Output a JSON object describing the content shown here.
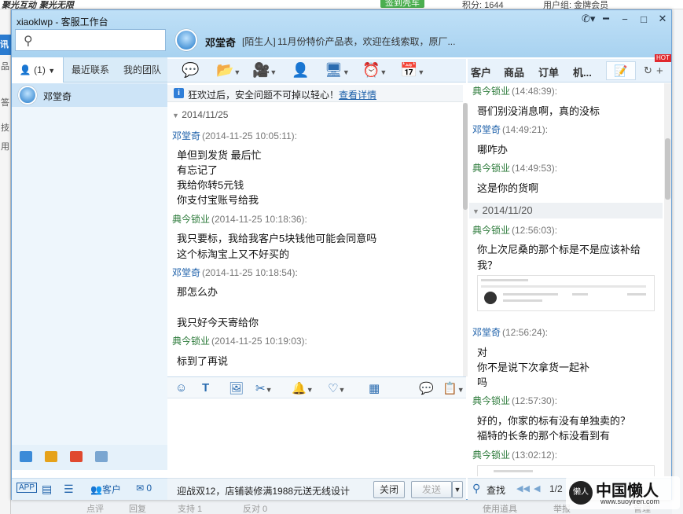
{
  "background": {
    "brand": "聚光互动 聚光无限",
    "signin_button": "签到壳车",
    "points": "积分: 1644",
    "group": "用户组: 金牌会员",
    "left_tab": "讯",
    "left_texts": [
      "品",
      "答",
      "技",
      "用"
    ],
    "bottom_items": [
      "点评",
      "回复",
      "支持 1",
      "反对 0",
      "使用道具",
      "举报",
      "管理"
    ]
  },
  "watermark": {
    "title": "中国懒人",
    "url": "www.suoyiren.com"
  },
  "window": {
    "title": "xiaoklwp - 客服工作台"
  },
  "search": {
    "placeholder": ""
  },
  "left_tabs": [
    {
      "label": "(1)"
    },
    {
      "label": "最近联系"
    },
    {
      "label": "我的团队"
    }
  ],
  "contacts": [
    {
      "name": "邓堂奇"
    }
  ],
  "left_bottom": {
    "app": "APP",
    "customers": "客户",
    "mail_count": "0"
  },
  "chat": {
    "name": "邓堂奇",
    "tag": "[陌生人]",
    "signature": "11月份特价产品表，欢迎在线索取，原厂..."
  },
  "notice": {
    "text": "狂欢过后，安全问题不可掉以轻心！",
    "link": "查看详情"
  },
  "messages": {
    "date": "2014/11/25",
    "m1": {
      "sender": "邓堂奇",
      "time": "(2014-11-25 10:05:11):",
      "lines": [
        "单但到发货 最后忙",
        "有忘记了",
        "我给你转5元钱",
        "你支付宝账号给我"
      ]
    },
    "m2": {
      "sender": "典今锁业",
      "time": "(2014-11-25 10:18:36):",
      "lines": [
        "我只要标，我给我客户5块钱他可能会同意吗",
        "这个标淘宝上又不好买的"
      ]
    },
    "m3": {
      "sender": "邓堂奇",
      "time": "(2014-11-25 10:18:54):",
      "lines": [
        "那怎么办",
        "",
        "我只好今天寄给你"
      ]
    },
    "m4": {
      "sender": "典今锁业",
      "time": "(2014-11-25 10:19:03):",
      "lines": [
        "标到了再说"
      ]
    }
  },
  "send_bar": {
    "promo": "迎战双12，店铺装修满1988元送无线设计",
    "close": "关闭",
    "send": "发送"
  },
  "right_tabs": [
    "客户",
    "商品",
    "订单",
    "机..."
  ],
  "right_hot": "HOT",
  "history": {
    "r1": {
      "sender": "典今锁业",
      "time": "(14:48:39):",
      "lines": [
        "哥们别没消息啊，真的没标"
      ]
    },
    "r2": {
      "sender": "邓堂奇",
      "time": "(14:49:21):",
      "lines": [
        "哪咋办"
      ]
    },
    "r3": {
      "sender": "典今锁业",
      "time": "(14:49:53):",
      "lines": [
        "这是你的货啊"
      ]
    },
    "date2": "2014/11/20",
    "r4": {
      "sender": "典今锁业",
      "time": "(12:56:03):",
      "lines": [
        "你上次尼桑的那个标是不是应该补给",
        "我？"
      ]
    },
    "r5": {
      "sender": "邓堂奇",
      "time": "(12:56:24):",
      "lines": [
        "对",
        "你不是说下次拿货一起补",
        "吗"
      ]
    },
    "r6": {
      "sender": "典今锁业",
      "time": "(12:57:30):",
      "lines": [
        "好的，你家的标有没有单独卖的？",
        "福特的长条的那个标没看到有"
      ]
    },
    "r7": {
      "sender": "典今锁业",
      "time": "(13:02:12):"
    }
  },
  "right_bottom": {
    "find": "查找",
    "page": "1/2"
  }
}
